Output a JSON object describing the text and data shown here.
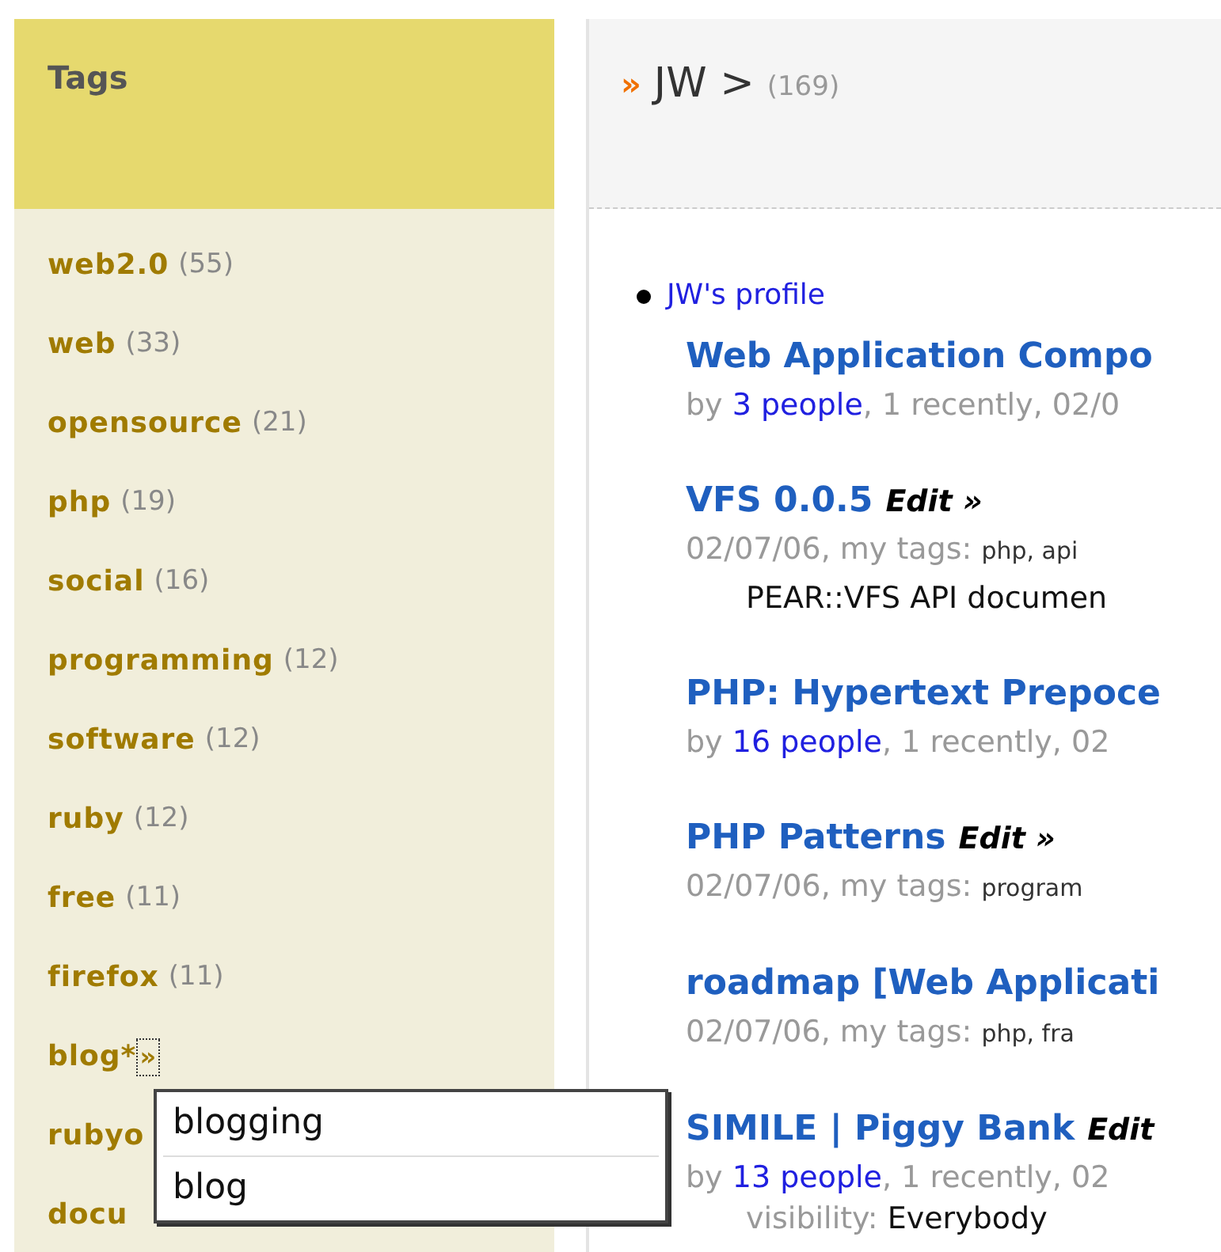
{
  "sidebar": {
    "title": "Tags",
    "tags": [
      {
        "name": "web2.0",
        "count": "(55)"
      },
      {
        "name": "web",
        "count": "(33)"
      },
      {
        "name": "opensource",
        "count": "(21)"
      },
      {
        "name": "php",
        "count": "(19)"
      },
      {
        "name": "social",
        "count": "(16)"
      },
      {
        "name": "programming",
        "count": "(12)"
      },
      {
        "name": "software",
        "count": "(12)"
      },
      {
        "name": "ruby",
        "count": "(12)"
      },
      {
        "name": "free",
        "count": "(11)"
      },
      {
        "name": "firefox",
        "count": "(11)"
      },
      {
        "name": "blog*",
        "expander": "»"
      },
      {
        "name": "rubyo"
      },
      {
        "name": "docu"
      }
    ]
  },
  "autocomplete": {
    "options": [
      "blogging",
      "blog"
    ]
  },
  "header": {
    "marker": "»",
    "breadcrumb": "JW >",
    "count": "(169)"
  },
  "profile_link": "JW's profile",
  "bookmarks": [
    {
      "title": "Web Application Compo",
      "meta": [
        {
          "kind": "text",
          "text": "by "
        },
        {
          "kind": "link",
          "text": "3 people"
        },
        {
          "kind": "text",
          "text": ", 1 recently, 02/0"
        }
      ]
    },
    {
      "title": "VFS 0.0.5",
      "edit": "Edit »",
      "meta": [
        {
          "kind": "text",
          "text": "02/07/06, my tags: "
        },
        {
          "kind": "tag",
          "text": "php, api"
        }
      ],
      "description": "PEAR::VFS API documen"
    },
    {
      "title": "PHP: Hypertext Prepoce",
      "meta": [
        {
          "kind": "text",
          "text": "by "
        },
        {
          "kind": "link",
          "text": "16 people"
        },
        {
          "kind": "text",
          "text": ", 1 recently, 02"
        }
      ]
    },
    {
      "title": "PHP Patterns",
      "edit": "Edit »",
      "meta": [
        {
          "kind": "text",
          "text": "02/07/06, my tags: "
        },
        {
          "kind": "tag",
          "text": "program"
        }
      ]
    },
    {
      "title": "roadmap [Web Applicati",
      "meta": [
        {
          "kind": "text",
          "text": "02/07/06, my tags: "
        },
        {
          "kind": "tag",
          "text": "php, fra"
        }
      ]
    },
    {
      "title": "SIMILE | Piggy Bank",
      "edit": "Edit",
      "meta": [
        {
          "kind": "text",
          "text": "by "
        },
        {
          "kind": "link",
          "text": "13 people"
        },
        {
          "kind": "text",
          "text": ", 1 recently, 02"
        }
      ],
      "visibility": {
        "label": "visibility: ",
        "value": "Everybody"
      }
    }
  ]
}
